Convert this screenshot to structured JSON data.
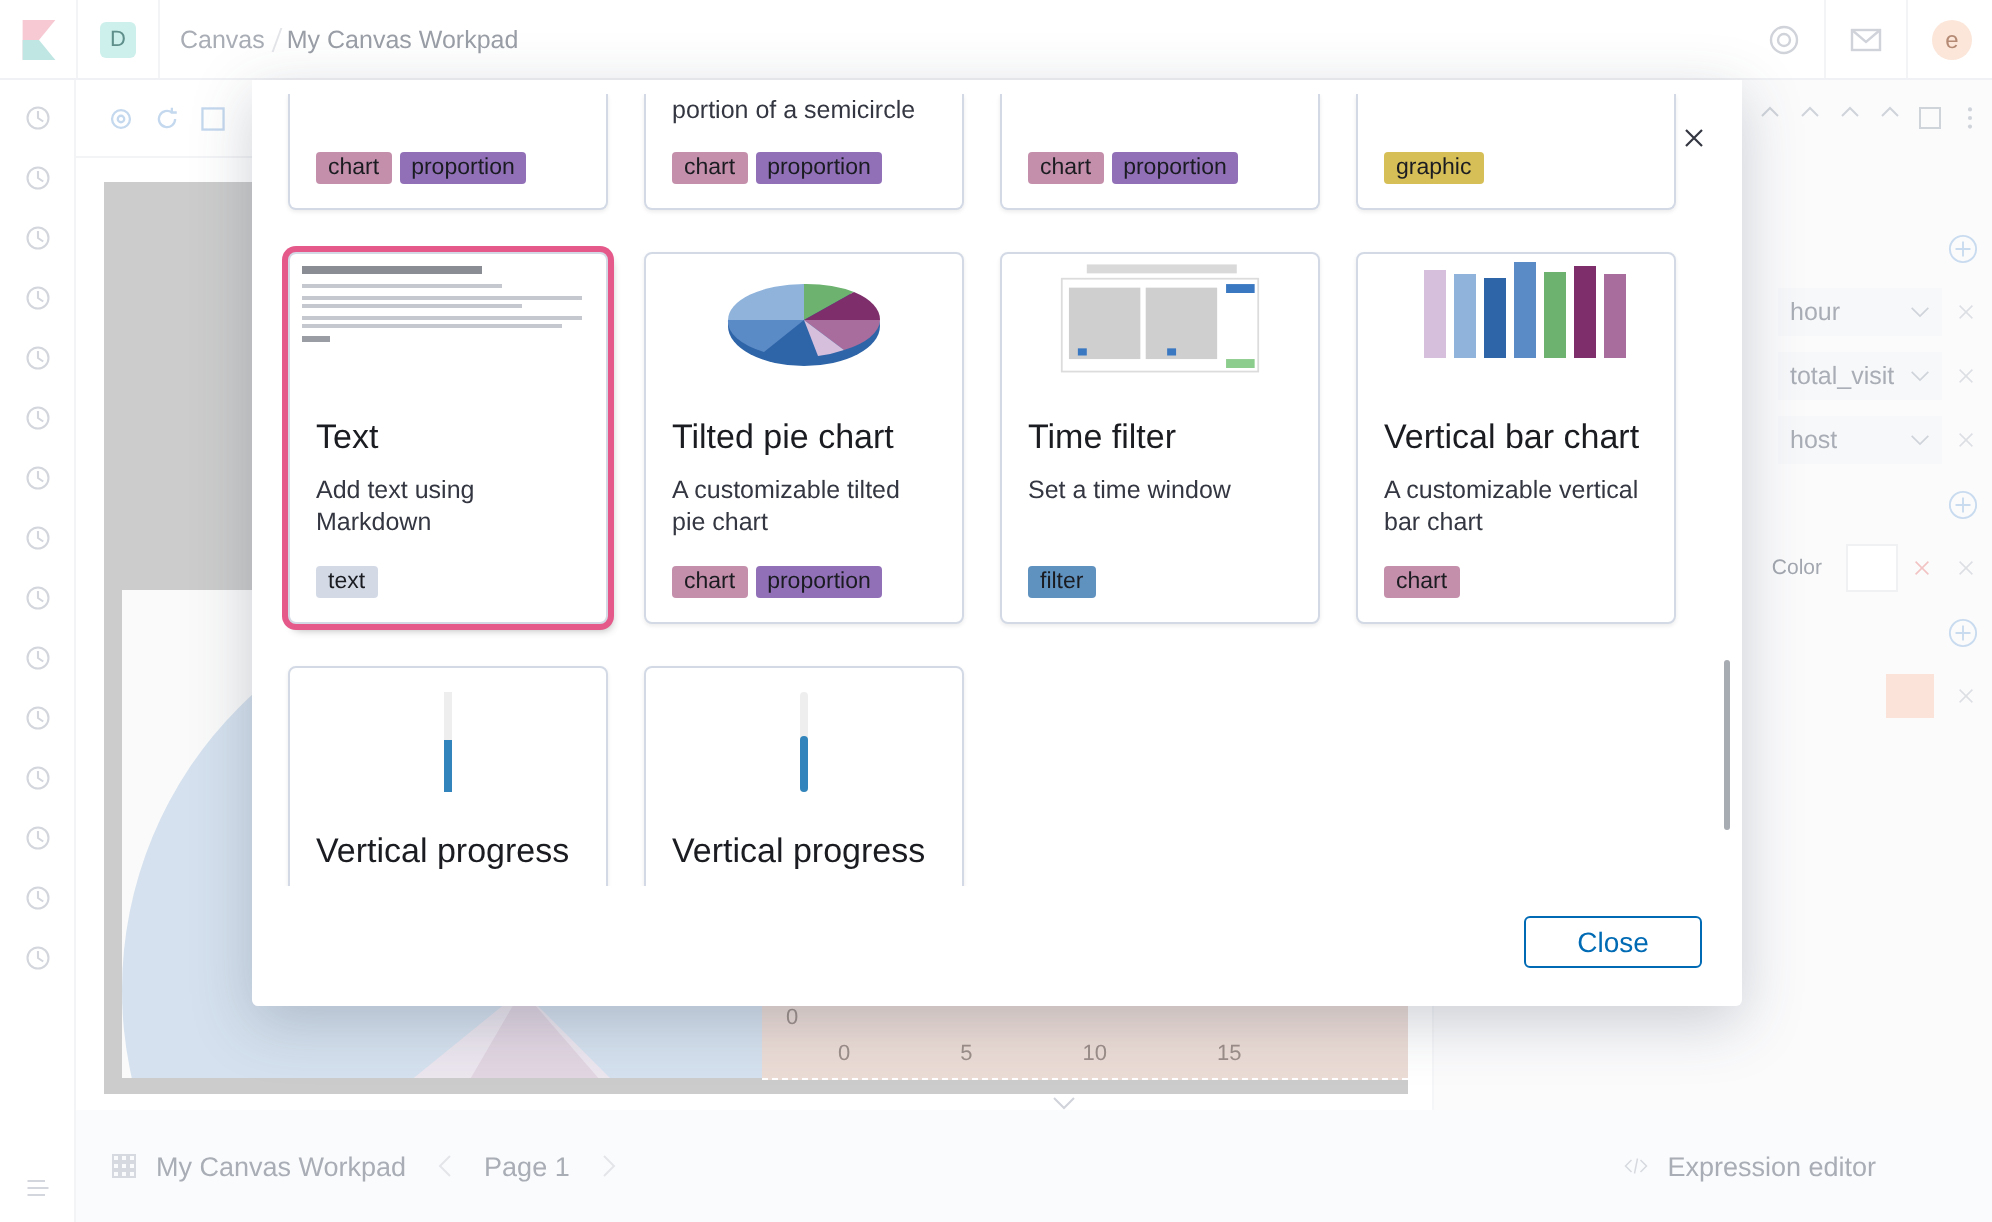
{
  "header": {
    "space_avatar": "D",
    "breadcrumbs": [
      "Canvas",
      "My Canvas Workpad"
    ],
    "user_avatar": "e"
  },
  "canvas": {
    "y_tick": "0",
    "x_ticks": [
      "0",
      "5",
      "10",
      "15"
    ]
  },
  "right_panel": {
    "fields": [
      "hour",
      "total_visit",
      "host"
    ],
    "color_label": "Color"
  },
  "footer": {
    "workpad": "My Canvas Workpad",
    "page": "Page 1",
    "expression_editor": "Expression editor"
  },
  "modal": {
    "cards": [
      {
        "selected": false,
        "tags": [
          {
            "label": "chart",
            "color": "#c48fab"
          },
          {
            "label": "proportion",
            "color": "#9170b8"
          }
        ]
      },
      {
        "selected": false,
        "description": "portion of a semicircle",
        "tags": [
          {
            "label": "chart",
            "color": "#c48fab"
          },
          {
            "label": "proportion",
            "color": "#9170b8"
          }
        ]
      },
      {
        "selected": false,
        "tags": [
          {
            "label": "chart",
            "color": "#c48fab"
          },
          {
            "label": "proportion",
            "color": "#9170b8"
          }
        ]
      },
      {
        "selected": false,
        "tags": [
          {
            "label": "graphic",
            "color": "#d6bf57"
          }
        ]
      },
      {
        "selected": true,
        "kind": "markdown",
        "title": "Text",
        "description": "Add text using Markdown",
        "tags": [
          {
            "label": "text",
            "color": "#d3dae6"
          }
        ]
      },
      {
        "selected": false,
        "kind": "tilted-pie",
        "title": "Tilted pie chart",
        "description": "A customizable tilted pie chart",
        "tags": [
          {
            "label": "chart",
            "color": "#c48fab"
          },
          {
            "label": "proportion",
            "color": "#9170b8"
          }
        ]
      },
      {
        "selected": false,
        "kind": "time-filter",
        "title": "Time filter",
        "description": "Set a time window",
        "tags": [
          {
            "label": "filter",
            "color": "#6092c0"
          }
        ]
      },
      {
        "selected": false,
        "kind": "bar-chart",
        "title": "Vertical bar chart",
        "description": "A customizable vertical bar chart",
        "tags": [
          {
            "label": "chart",
            "color": "#c48fab"
          }
        ]
      },
      {
        "selected": false,
        "kind": "progress-bar",
        "title": "Vertical progress"
      },
      {
        "selected": false,
        "kind": "progress-pill",
        "title": "Vertical progress"
      }
    ],
    "close_button": "Close"
  }
}
